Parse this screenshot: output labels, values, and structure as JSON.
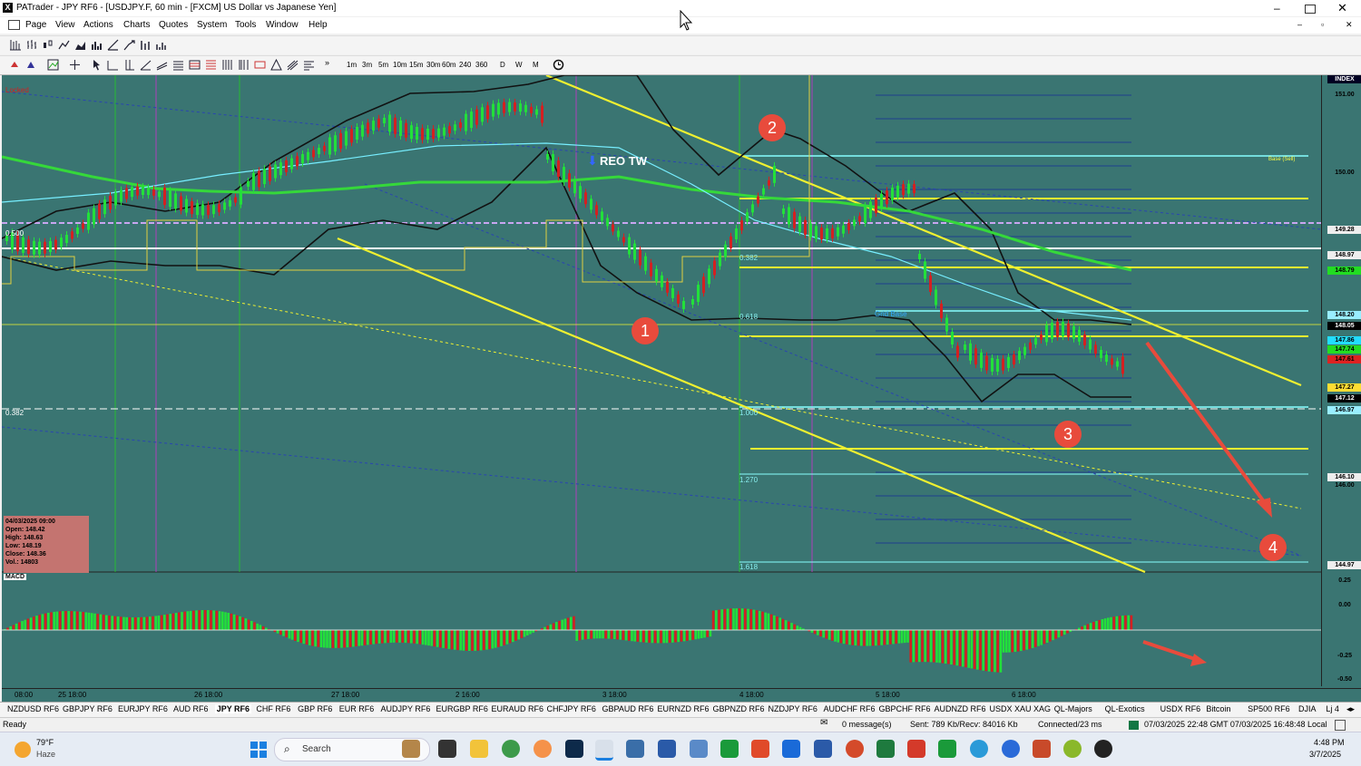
{
  "window": {
    "title": "PATrader - JPY RF6 - [USDJPY.F, 60 min - [FXCM] US Dollar vs Japanese Yen]"
  },
  "menu": [
    "Page",
    "View",
    "Actions",
    "Charts",
    "Quotes",
    "System",
    "Tools",
    "Window",
    "Help"
  ],
  "timeframes": [
    "1m",
    "3m",
    "5m",
    "10m",
    "15m",
    "30m",
    "60m",
    "240",
    "360",
    "D",
    "W",
    "M"
  ],
  "chart": {
    "locked_label": "Locked",
    "annotation_text": "REO TW",
    "fib_left": [
      "0.500",
      "0.382"
    ],
    "fib_mid": [
      "0.382",
      "0.618",
      "1.000",
      "1.270",
      "1.618"
    ],
    "grid_base_label": "Grid Base",
    "base_sell_label": "Base (Sell)",
    "index_label": "INDEX",
    "price_scale": [
      "151.00",
      "150.00",
      "149.28",
      "148.97",
      "148.79",
      "148.20",
      "148.05",
      "147.86",
      "147.74",
      "147.61",
      "147.27",
      "147.12",
      "146.97",
      "146.10",
      "146.00",
      "144.97"
    ],
    "time_labels": [
      "08:00",
      "25 18:00",
      "26 18:00",
      "27 18:00",
      "2 16:00",
      "3 18:00",
      "4 18:00",
      "5 18:00",
      "6 18:00"
    ],
    "circle_labels": [
      "1",
      "2",
      "3",
      "4"
    ]
  },
  "ohlc_box": {
    "date": "04/03/2025 09:00",
    "open": "Open: 148.42",
    "high": "High: 148.63",
    "low": "Low: 148.19",
    "close": "Close: 148.36",
    "vol": "Vol.: 14803"
  },
  "macd": {
    "label": "MACD",
    "scale": [
      "0.25",
      "0.00",
      "-0.25",
      "-0.50"
    ]
  },
  "tabs": [
    "NZDUSD RF6",
    "GBPJPY RF6",
    "EURJPY RF6",
    "AUD RF6",
    "JPY RF6",
    "CHF RF6",
    "GBP RF6",
    "EUR RF6",
    "AUDJPY RF6",
    "EURGBP RF6",
    "EURAUD RF6",
    "CHFJPY RF6",
    "GBPAUD RF6",
    "EURNZD RF6",
    "GBPNZD RF6",
    "NZDJPY RF6",
    "AUDCHF RF6",
    "GBPCHF RF6",
    "AUDNZD RF6",
    "USDX XAU XAG",
    "QL-Majors",
    "QL-Exotics",
    "USDX RF6",
    "Bitcoin",
    "SP500 RF6",
    "DJIA",
    "Lj 4"
  ],
  "active_tab": "JPY RF6",
  "status": {
    "ready": "Ready",
    "messages": "0 message(s)",
    "sent": "Sent: 789 Kb/Recv: 84016 Kb",
    "connected": "Connected/23 ms",
    "time": "07/03/2025 22:48 GMT  07/03/2025 16:48:48 Local"
  },
  "taskbar": {
    "weather_temp": "79°F",
    "weather_desc": "Haze",
    "search_placeholder": "Search",
    "clock_time": "4:48 PM",
    "clock_date": "3/7/2025"
  },
  "colors": {
    "chart_bg": "#3a7572",
    "bull": "#22e03a",
    "bear": "#d42020",
    "yellow_line": "#f0f030",
    "accent_circle": "#e84b3c"
  }
}
